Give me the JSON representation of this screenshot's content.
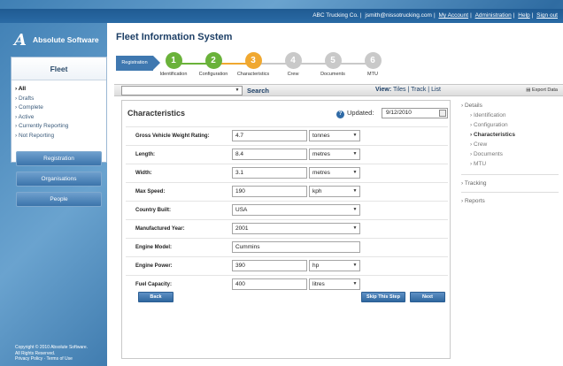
{
  "topbar": {
    "company": "ABC Trucking Co.",
    "email": "jsmith@nissotrucking.com",
    "links": [
      "My Account",
      "Administration",
      "Help",
      "Sign out"
    ]
  },
  "logo": {
    "mark": "A",
    "name": "Absolute Software"
  },
  "fleet": {
    "title": "Fleet",
    "items": [
      "All",
      "Drafts",
      "Complete",
      "Active",
      "Currently Reporting",
      "Not Reporting"
    ]
  },
  "nav": {
    "registration": "Registration",
    "organisations": "Organisations",
    "people": "People"
  },
  "copyright": {
    "line1": "Copyright © 2010 Absolute Software.",
    "line2": "All Rights Reserved.",
    "line3": "Privacy Policy · Terms of Use"
  },
  "app": {
    "title": "Fleet Information System"
  },
  "steps": {
    "tab": "Registration",
    "items": [
      {
        "num": "1",
        "label": "Identification",
        "color": "#6ab23a"
      },
      {
        "num": "2",
        "label": "Configuration",
        "color": "#6ab23a"
      },
      {
        "num": "3",
        "label": "Characteristics",
        "color": "#f0a830"
      },
      {
        "num": "4",
        "label": "Crew",
        "color": "#c9c9c9"
      },
      {
        "num": "5",
        "label": "Documents",
        "color": "#c9c9c9"
      },
      {
        "num": "6",
        "label": "MTU",
        "color": "#c9c9c9"
      }
    ]
  },
  "toolbar": {
    "search": "Search",
    "view_label": "View:",
    "tiles": "Tiles",
    "track": "Track",
    "list": "List",
    "export": "Export Data"
  },
  "form": {
    "title": "Characteristics",
    "updated_label": "Updated:",
    "updated_value": "9/12/2010",
    "fields": [
      {
        "label": "Gross Vehicle Weight Rating:",
        "value": "4.7",
        "unit": "tonnes",
        "kind": "text"
      },
      {
        "label": "Length:",
        "value": "8.4",
        "unit": "metres",
        "kind": "text"
      },
      {
        "label": "Width:",
        "value": "3.1",
        "unit": "metres",
        "kind": "text"
      },
      {
        "label": "Max Speed:",
        "value": "190",
        "unit": "kph",
        "kind": "text"
      },
      {
        "label": "Country Built:",
        "value": "USA",
        "unit": "",
        "kind": "select"
      },
      {
        "label": "Manufactured Year:",
        "value": "2001",
        "unit": "",
        "kind": "select"
      },
      {
        "label": "Engine Model:",
        "value": "Cummins",
        "unit": "",
        "kind": "text"
      },
      {
        "label": "Engine Power:",
        "value": "390",
        "unit": "hp",
        "kind": "text"
      },
      {
        "label": "Fuel Capacity:",
        "value": "400",
        "unit": "litres",
        "kind": "text"
      }
    ],
    "back": "Back",
    "skip": "Skip This Step",
    "next": "Next"
  },
  "rightnav": {
    "details": "Details",
    "details_items": [
      "Identification",
      "Configuration",
      "Characteristics",
      "Crew",
      "Documents",
      "MTU"
    ],
    "active": "Characteristics",
    "tracking": "Tracking",
    "reports": "Reports"
  }
}
